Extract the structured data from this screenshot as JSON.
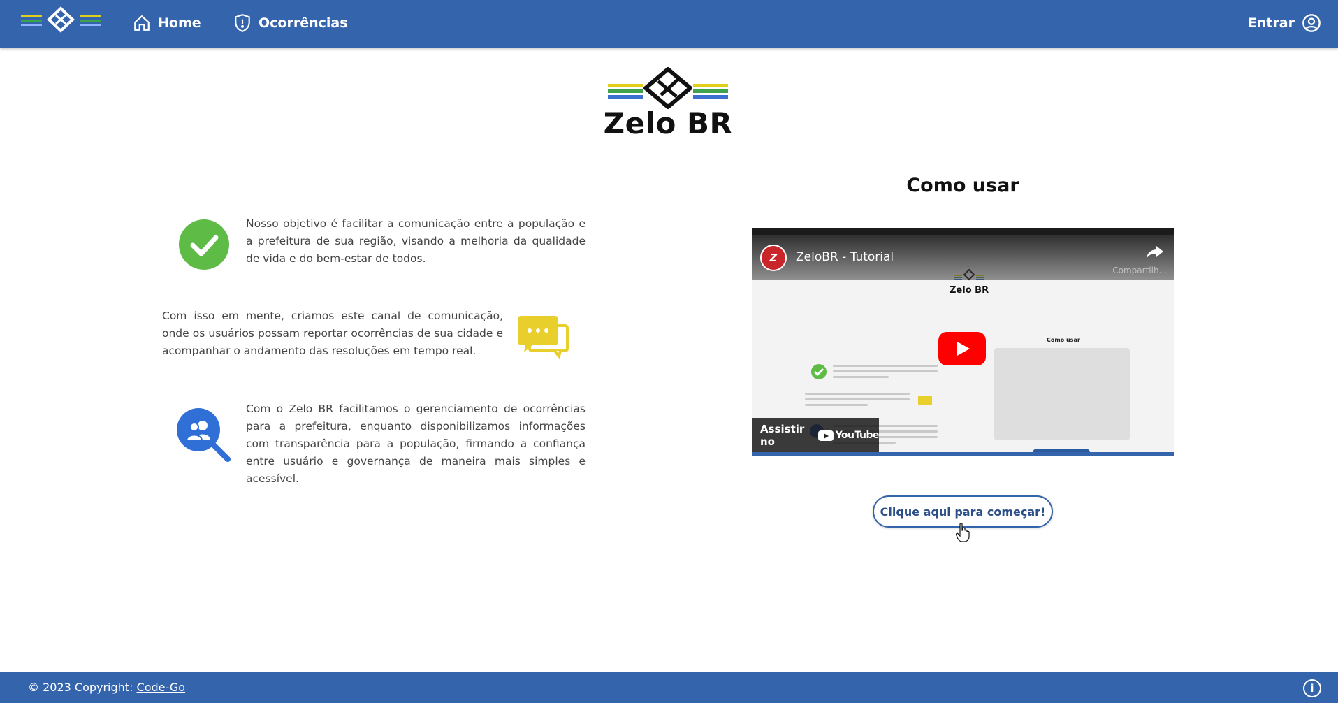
{
  "nav": {
    "home_label": "Home",
    "occurrences_label": "Ocorrências",
    "login_label": "Entrar"
  },
  "brand": {
    "title": "Zelo BR"
  },
  "features": [
    {
      "text": "Nosso objetivo é facilitar a comunicação entre a população e a prefeitura de sua região, visando a melhoria da qualidade de vida e do bem-estar de todos.",
      "icon": "check-circle-icon"
    },
    {
      "text": "Com isso em mente, criamos este canal de comunicação, onde os usuários possam reportar ocorrências de sua cidade e acompanhar o andamento das resoluções em tempo real.",
      "icon": "chat-bubbles-icon"
    },
    {
      "text": "Com o Zelo BR facilitamos o gerenciamento de ocorrências para a prefeitura, enquanto disponibilizamos informações com transparência para a população, firmando a confiança entre usuário e governança de maneira mais simples e acessível.",
      "icon": "user-search-icon"
    }
  ],
  "howto": {
    "title": "Como usar",
    "video": {
      "channel_initials": "Z",
      "title": "ZeloBR - Tutorial",
      "share_label": "Compartilh...",
      "watch_label": "Assistir no",
      "youtube_label": "YouTube",
      "mini_brand": "Zelo BR",
      "mini_title": "Como usar"
    },
    "cta_label": "Clique aqui para começar!"
  },
  "footer": {
    "copyright": "© 2023 Copyright: ",
    "link_label": "Code-Go"
  },
  "colors": {
    "primary": "#3464ac",
    "check_green": "#5dbb46",
    "chat_yellow": "#e8cf2c",
    "search_blue": "#2f6fd6",
    "stripe_yellow": "#e0cf1b",
    "stripe_green": "#3fa34d",
    "stripe_blue": "#3b6fd0"
  }
}
